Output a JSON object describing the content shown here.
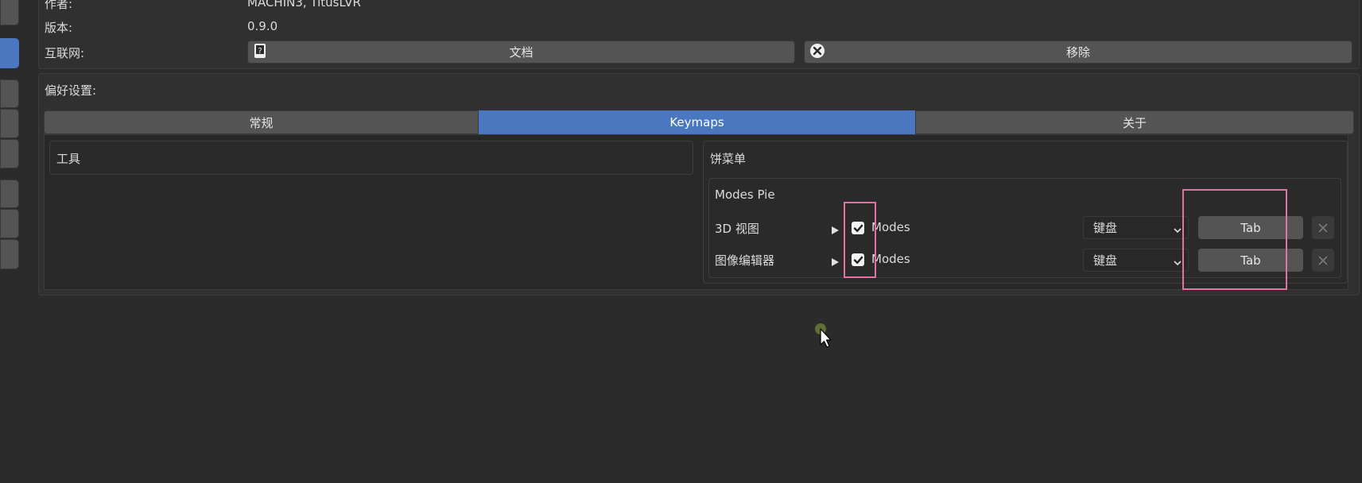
{
  "addon_info": {
    "author_label": "作者:",
    "author_value": "MACHIN3, TitusLVR",
    "version_label": "版本:",
    "version_value": "0.9.0",
    "internet_label": "互联网:",
    "docs_button": "文档",
    "remove_button": "移除"
  },
  "preferences": {
    "title": "偏好设置:",
    "tabs": [
      {
        "label": "常规",
        "active": false
      },
      {
        "label": "Keymaps",
        "active": true
      },
      {
        "label": "关于",
        "active": false
      }
    ],
    "tools_title": "工具",
    "pie_menu_title": "饼菜单",
    "modes_pie": {
      "title": "Modes Pie",
      "rows": [
        {
          "label": "3D 视图",
          "checked": true,
          "name": "Modes",
          "input_type": "键盘",
          "key": "Tab"
        },
        {
          "label": "图像编辑器",
          "checked": true,
          "name": "Modes",
          "input_type": "键盘",
          "key": "Tab"
        }
      ]
    }
  },
  "colors": {
    "accent": "#4a77c0",
    "highlight": "#e86fa6",
    "background": "#2b2b2b"
  },
  "icons": [
    "book-icon",
    "close-circle-icon",
    "expand-arrow-icon",
    "checkmark-icon",
    "chevron-down-icon",
    "close-icon",
    "mouse-cursor-icon"
  ]
}
